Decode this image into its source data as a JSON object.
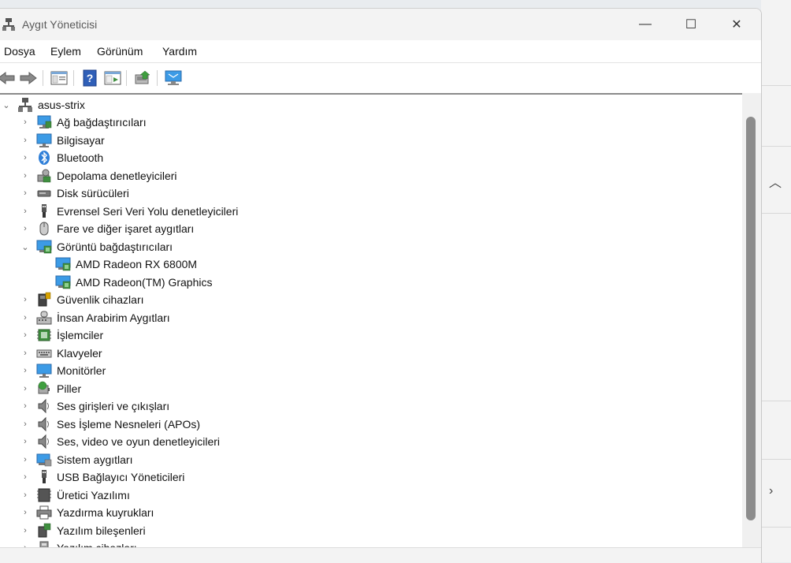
{
  "window": {
    "title": "Aygıt Yöneticisi",
    "icon": "device-manager-icon",
    "controls": {
      "minimize": "—",
      "maximize": "☐",
      "close": "✕"
    }
  },
  "menu": [
    "Dosya",
    "Eylem",
    "Görünüm",
    "Yardım"
  ],
  "toolbar": {
    "icons": [
      "back-arrow-icon",
      "forward-arrow-icon",
      "properties-icon",
      "help-icon",
      "update-driver-icon",
      "uninstall-icon",
      "scan-hardware-icon"
    ]
  },
  "tree": {
    "root": "asus-strix",
    "items": [
      {
        "label": "Ağ bağdaştırıcıları",
        "icon": "network-adapter-icon",
        "expanded": false
      },
      {
        "label": "Bilgisayar",
        "icon": "computer-icon",
        "expanded": false
      },
      {
        "label": "Bluetooth",
        "icon": "bluetooth-icon",
        "expanded": false
      },
      {
        "label": "Depolama denetleyicileri",
        "icon": "storage-controller-icon",
        "expanded": false
      },
      {
        "label": "Disk sürücüleri",
        "icon": "disk-drive-icon",
        "expanded": false
      },
      {
        "label": "Evrensel Seri Veri Yolu denetleyicileri",
        "icon": "usb-controller-icon",
        "expanded": false
      },
      {
        "label": "Fare ve diğer işaret aygıtları",
        "icon": "mouse-icon",
        "expanded": false
      },
      {
        "label": "Görüntü bağdaştırıcıları",
        "icon": "display-adapter-icon",
        "expanded": true,
        "children": [
          {
            "label": "AMD Radeon RX 6800M",
            "icon": "display-adapter-icon"
          },
          {
            "label": "AMD Radeon(TM) Graphics",
            "icon": "display-adapter-icon"
          }
        ]
      },
      {
        "label": "Güvenlik cihazları",
        "icon": "security-device-icon",
        "expanded": false
      },
      {
        "label": "İnsan Arabirim Aygıtları",
        "icon": "hid-icon",
        "expanded": false
      },
      {
        "label": "İşlemciler",
        "icon": "processor-icon",
        "expanded": false
      },
      {
        "label": "Klavyeler",
        "icon": "keyboard-icon",
        "expanded": false
      },
      {
        "label": "Monitörler",
        "icon": "monitor-icon",
        "expanded": false
      },
      {
        "label": "Piller",
        "icon": "battery-icon",
        "expanded": false
      },
      {
        "label": "Ses girişleri ve çıkışları",
        "icon": "speaker-icon",
        "expanded": false
      },
      {
        "label": "Ses İşleme Nesneleri (APOs)",
        "icon": "speaker-icon",
        "expanded": false
      },
      {
        "label": "Ses, video ve oyun denetleyicileri",
        "icon": "speaker-icon",
        "expanded": false
      },
      {
        "label": "Sistem aygıtları",
        "icon": "system-device-icon",
        "expanded": false
      },
      {
        "label": "USB Bağlayıcı Yöneticileri",
        "icon": "usb-connector-icon",
        "expanded": false
      },
      {
        "label": "Üretici Yazılımı",
        "icon": "firmware-icon",
        "expanded": false
      },
      {
        "label": "Yazdırma kuyrukları",
        "icon": "printer-icon",
        "expanded": false
      },
      {
        "label": "Yazılım bileşenleri",
        "icon": "software-component-icon",
        "expanded": false
      },
      {
        "label": "Yazılım cihazları",
        "icon": "software-device-icon",
        "expanded": false
      }
    ]
  },
  "colors": {
    "accent_blue": "#2f7fd8",
    "monitor_screen": "#3c9be6",
    "chip_green": "#3f8f3f",
    "scroll_thumb": "#8c8c8c"
  }
}
